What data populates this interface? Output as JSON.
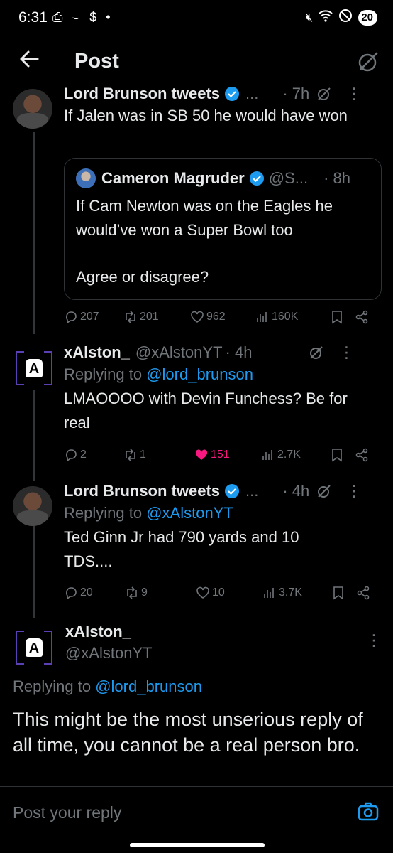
{
  "status_bar": {
    "time": "6:31",
    "left_icons": "⎙ ⌣ $ •",
    "battery": "20"
  },
  "header": {
    "title": "Post",
    "back_icon": "arrow-left-icon",
    "right_icon": "grok-icon"
  },
  "tweets": [
    {
      "name": "Lord Brunson tweets",
      "handle": "...",
      "time": "· 7h",
      "text": "If Jalen was in SB 50 he would have won",
      "quote": {
        "name": "Cameron Magruder",
        "handle": "@S...",
        "time": "· 8h",
        "text1": "If Cam Newton was on the Eagles he would’ve won a Super Bowl too",
        "text2": "Agree or disagree?"
      },
      "replies": "207",
      "reposts": "201",
      "likes": "962",
      "views": "160K"
    },
    {
      "name": "xAlston_",
      "handle": "@xAlstonYT",
      "time": "· 4h",
      "replying_prefix": "Replying to",
      "replying_to": "@lord_brunson",
      "text": "LMAOOOO with Devin Funchess? Be for real",
      "replies": "2",
      "reposts": "1",
      "likes": "151",
      "views": "2.7K"
    },
    {
      "name": "Lord Brunson tweets",
      "handle": "...",
      "time": "· 4h",
      "replying_prefix": "Replying to",
      "replying_to": "@xAlstonYT",
      "text": "Ted Ginn Jr had 790 yards and 10 TDS....",
      "replies": "20",
      "reposts": "9",
      "likes": "10",
      "views": "3.7K"
    }
  ],
  "main_post": {
    "name": "xAlston_",
    "handle": "@xAlstonYT",
    "replying_prefix": "Replying to",
    "replying_to": "@lord_brunson",
    "text": "This might be the most unserious reply of all time, you cannot be a real person bro."
  },
  "reply_bar": {
    "placeholder": "Post your reply",
    "icon": "camera-icon"
  },
  "colors": {
    "accent": "#1d9bf0",
    "like": "#f91880",
    "muted": "#71767b"
  }
}
